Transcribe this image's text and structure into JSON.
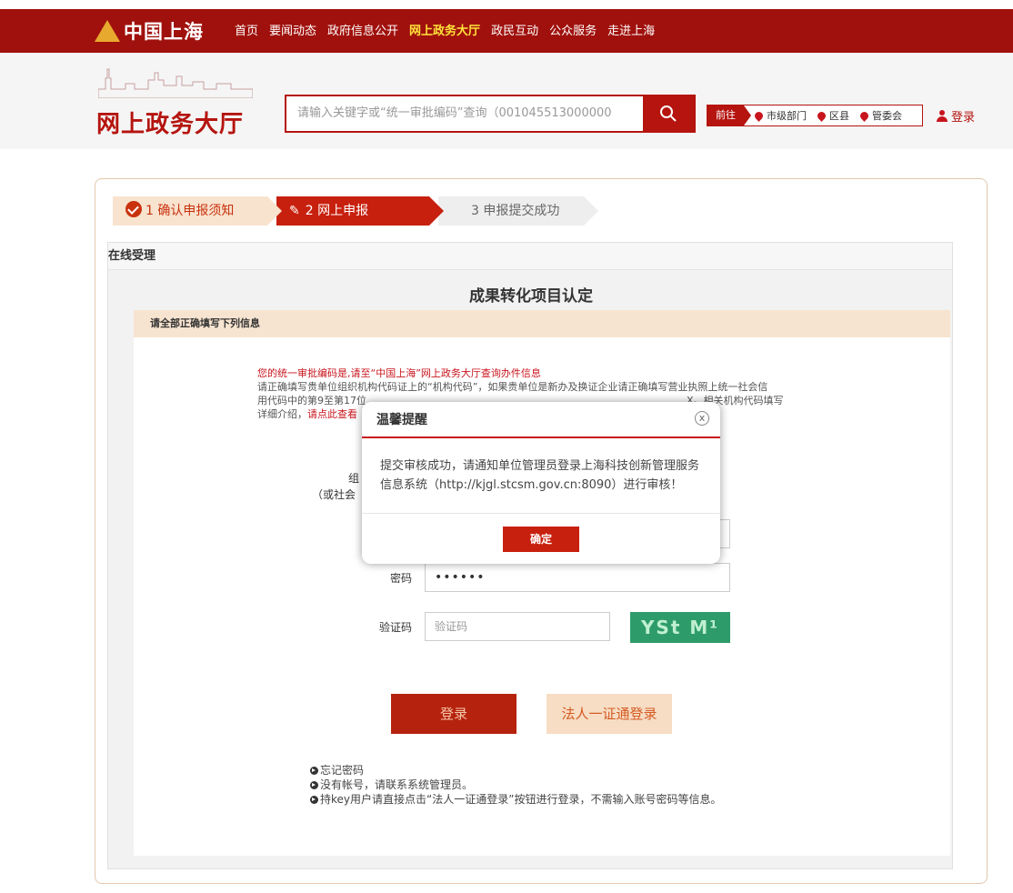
{
  "brand": {
    "name": "中国上海"
  },
  "topnav": [
    {
      "label": "首页",
      "active": false
    },
    {
      "label": "要闻动态",
      "active": false
    },
    {
      "label": "政府信息公开",
      "active": false
    },
    {
      "label": "网上政务大厅",
      "active": true
    },
    {
      "label": "政民互动",
      "active": false
    },
    {
      "label": "公众服务",
      "active": false
    },
    {
      "label": "走进上海",
      "active": false
    }
  ],
  "header": {
    "title": "网上政务大厅",
    "search_placeholder": "请输入关键字或“统一审批编码”查询（001045513000000",
    "goto_label": "前往",
    "goto_items": [
      "市级部门",
      "区县",
      "管委会"
    ],
    "login_label": "登录"
  },
  "steps": [
    {
      "label": "1 确认申报须知"
    },
    {
      "label": "2 网上申报"
    },
    {
      "label": "3 申报提交成功"
    }
  ],
  "section": {
    "head": "在线受理",
    "form_title": "成果转化项目认定",
    "subhead": "请全部正确填写下列信息"
  },
  "notice": {
    "line1": "您的统一审批编码是,请至“中国上海”网上政务大厅查询办件信息",
    "line2": "请正确填写贵单位组织机构代码证上的“机构代码”，如果贵单位是新办及换证企业请正确填写营业执照上统一社会信",
    "line3a": "用代码中的第9至第17位",
    "line3b": "X。相关机构代码填写",
    "line4a": "详细介绍，",
    "line4b": "请点此查看"
  },
  "form": {
    "org_label_partial": "组",
    "org_sub_partial": "（或社会",
    "password_label": "密码",
    "password_value": "••••••",
    "captcha_label": "验证码",
    "captcha_placeholder": "验证码",
    "captcha_text": "YSt M¹"
  },
  "buttons": {
    "login": "登录",
    "legal_login": "法人一证通登录"
  },
  "tips": [
    "忘记密码",
    "没有帐号，请联系系统管理员。",
    "持key用户请直接点击“法人一证通登录”按钮进行登录，不需输入账号密码等信息。"
  ],
  "modal": {
    "title": "温馨提醒",
    "close": "x",
    "message": "提交审核成功，请通知单位管理员登录上海科技创新管理服务信息系统（http://kjgl.stcsm.gov.cn:8090）进行审核！",
    "ok": "确定"
  },
  "colors": {
    "brand_red": "#a0110d",
    "accent": "#c8200e"
  }
}
